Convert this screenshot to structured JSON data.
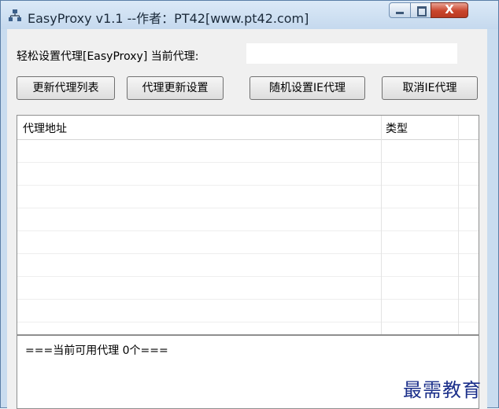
{
  "window": {
    "title": "EasyProxy v1.1 --作者：PT42[www.pt42.com]",
    "close_glyph": "X"
  },
  "header": {
    "label": "轻松设置代理[EasyProxy]   当前代理:",
    "current_proxy": ""
  },
  "toolbar": {
    "refresh_label": "更新代理列表",
    "settings_label": "代理更新设置",
    "random_label": "随机设置IE代理",
    "cancel_label": "取消IE代理"
  },
  "list": {
    "columns": [
      "代理地址",
      "类型"
    ],
    "rows": []
  },
  "status": {
    "text": "===当前可用代理 0个==="
  },
  "watermark": {
    "text": "最需教育"
  },
  "colors": {
    "titlebar": "#c9dcef",
    "close_button": "#c9452c",
    "watermark": "#1b2f8a"
  }
}
